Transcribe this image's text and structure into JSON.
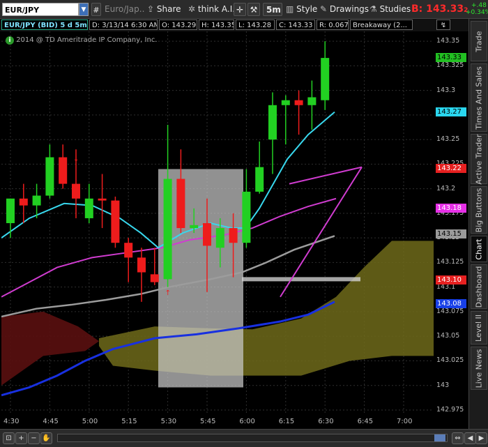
{
  "toolbar": {
    "symbol": "EUR/JPY",
    "description": "Euro/Jap...",
    "share": "Share",
    "think": "think A.I.",
    "interval": "5m",
    "style": "Style",
    "drawings": "Drawings",
    "studies": "Studies",
    "bid": "B: 143.33",
    "bid_small": "2",
    "change_pts": "+.48",
    "change_pct": "+0.34%"
  },
  "info_row": {
    "symbol": "EUR/JPY (BID) 5 d 5m",
    "date": "D: 3/13/14 6:30 AM",
    "open": "O: 143.29",
    "high": "H: 143.35",
    "low": "L: 143.28",
    "close": "C: 143.33",
    "range": "R: 0.067",
    "pattern": "Breakaway (2..."
  },
  "watermark": "2014 @ TD Ameritrade IP Company, Inc.",
  "y_ticks": [
    "143.35",
    "143.325",
    "143.3",
    "143.275",
    "143.25",
    "143.225",
    "143.2",
    "143.175",
    "143.15",
    "143.125",
    "143.1",
    "143.075",
    "143.05",
    "143.025",
    "143",
    "142.975"
  ],
  "y_badges": [
    {
      "text": "143.33",
      "bg": "#22c022",
      "fg": "#000",
      "v": 143.333
    },
    {
      "text": "143.27",
      "bg": "#2ad7ef",
      "fg": "#000",
      "v": 143.278
    },
    {
      "text": "143.22",
      "bg": "#e62020",
      "fg": "#fff",
      "v": 143.22
    },
    {
      "text": "143.18",
      "bg": "#e62fe6",
      "fg": "#fff",
      "v": 143.18
    },
    {
      "text": "143.15",
      "bg": "#9a9a9a",
      "fg": "#000",
      "v": 143.154
    },
    {
      "text": "143.10",
      "bg": "#e62020",
      "fg": "#fff",
      "v": 143.107
    },
    {
      "text": "143.08",
      "bg": "#1840e8",
      "fg": "#fff",
      "v": 143.083
    }
  ],
  "x_ticks": [
    "4:30",
    "4:45",
    "5:00",
    "5:15",
    "5:30",
    "5:45",
    "6:00",
    "6:15",
    "6:30",
    "6:45",
    "7:00"
  ],
  "tabs": [
    "Trade",
    "Times And Sales",
    "Active Trader",
    "Big Buttons",
    "Chart",
    "Dashboard",
    "Level II",
    "Live News"
  ],
  "colors": {
    "up": "#22d022",
    "down": "#ee1c1c",
    "cyan": "#38d8ee",
    "magenta": "#d03cd0",
    "gray": "#9c9c9c",
    "blue": "#1830e0",
    "cloud": "#6e6a1a"
  },
  "chart_data": {
    "type": "candlestick",
    "ylim": [
      142.97,
      143.36
    ],
    "candles": [
      {
        "t": "4:30",
        "o": 143.165,
        "h": 143.19,
        "l": 143.15,
        "c": 143.19
      },
      {
        "t": "4:35",
        "o": 143.19,
        "h": 143.205,
        "l": 143.165,
        "c": 143.183
      },
      {
        "t": "4:40",
        "o": 143.183,
        "h": 143.205,
        "l": 143.17,
        "c": 143.193
      },
      {
        "t": "4:45",
        "o": 143.193,
        "h": 143.245,
        "l": 143.19,
        "c": 143.232
      },
      {
        "t": "4:50",
        "o": 143.232,
        "h": 143.245,
        "l": 143.2,
        "c": 143.205
      },
      {
        "t": "4:55",
        "o": 143.205,
        "h": 143.24,
        "l": 143.17,
        "c": 143.19
      },
      {
        "t": "5:00",
        "o": 143.17,
        "h": 143.205,
        "l": 143.165,
        "c": 143.19
      },
      {
        "t": "5:05",
        "o": 143.19,
        "h": 143.215,
        "l": 143.16,
        "c": 143.188
      },
      {
        "t": "5:10",
        "o": 143.188,
        "h": 143.192,
        "l": 143.14,
        "c": 143.145
      },
      {
        "t": "5:15",
        "o": 143.145,
        "h": 143.15,
        "l": 143.105,
        "c": 143.13
      },
      {
        "t": "5:20",
        "o": 143.13,
        "h": 143.14,
        "l": 143.085,
        "c": 143.115
      },
      {
        "t": "5:25",
        "o": 143.113,
        "h": 143.14,
        "l": 143.102,
        "c": 143.105
      },
      {
        "t": "5:30",
        "o": 143.108,
        "h": 143.265,
        "l": 143.1,
        "c": 143.21
      },
      {
        "t": "5:35",
        "o": 143.21,
        "h": 143.24,
        "l": 143.155,
        "c": 143.16
      },
      {
        "t": "5:40",
        "o": 143.16,
        "h": 143.18,
        "l": 143.155,
        "c": 143.163
      },
      {
        "t": "5:45",
        "o": 143.165,
        "h": 143.19,
        "l": 143.095,
        "c": 143.142
      },
      {
        "t": "5:50",
        "o": 143.14,
        "h": 143.17,
        "l": 143.12,
        "c": 143.16
      },
      {
        "t": "5:55",
        "o": 143.16,
        "h": 143.175,
        "l": 143.11,
        "c": 143.145
      },
      {
        "t": "6:00",
        "o": 143.145,
        "h": 143.22,
        "l": 143.14,
        "c": 143.197
      },
      {
        "t": "6:05",
        "o": 143.197,
        "h": 143.248,
        "l": 143.195,
        "c": 143.222
      },
      {
        "t": "6:10",
        "o": 143.25,
        "h": 143.298,
        "l": 143.215,
        "c": 143.285
      },
      {
        "t": "6:15",
        "o": 143.285,
        "h": 143.295,
        "l": 143.245,
        "c": 143.29
      },
      {
        "t": "6:20",
        "o": 143.29,
        "h": 143.3,
        "l": 143.255,
        "c": 143.285
      },
      {
        "t": "6:25",
        "o": 143.285,
        "h": 143.31,
        "l": 143.26,
        "c": 143.293
      },
      {
        "t": "6:30",
        "o": 143.29,
        "h": 143.35,
        "l": 143.28,
        "c": 143.333
      }
    ]
  }
}
